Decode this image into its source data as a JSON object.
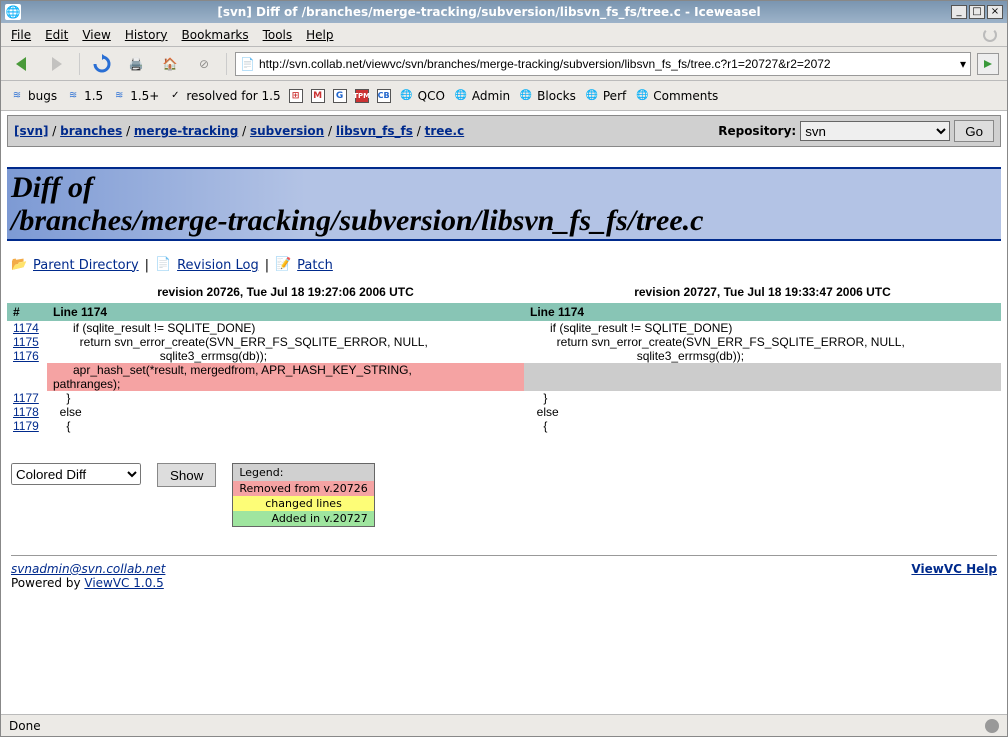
{
  "window": {
    "title": "[svn] Diff of /branches/merge-tracking/subversion/libsvn_fs_fs/tree.c - Iceweasel"
  },
  "menubar": {
    "items": [
      "File",
      "Edit",
      "View",
      "History",
      "Bookmarks",
      "Tools",
      "Help"
    ]
  },
  "url": "http://svn.collab.net/viewvc/svn/branches/merge-tracking/subversion/libsvn_fs_fs/tree.c?r1=20727&r2=2072",
  "bookmarks": {
    "bugs": "bugs",
    "v15": "1.5",
    "v15p": "1.5+",
    "resolved": "resolved for 1.5",
    "qco": "QCO",
    "admin": "Admin",
    "blocks": "Blocks",
    "perf": "Perf",
    "comments": "Comments"
  },
  "pathbar": {
    "root": "[svn]",
    "p1": "branches",
    "p2": "merge-tracking",
    "p3": "subversion",
    "p4": "libsvn_fs_fs",
    "p5": "tree.c",
    "sep": " / ",
    "repo_label": "Repository:",
    "repo_value": "svn",
    "go": "Go"
  },
  "heading": {
    "l1": "Diff of",
    "l2": "/branches/merge-tracking/subversion/libsvn_fs_fs/tree.c"
  },
  "actions": {
    "parent": "Parent Directory",
    "revlog": "Revision Log",
    "patch": "Patch",
    "sep": " | "
  },
  "diff": {
    "rev_left": "revision 20726, Tue Jul 18 19:27:06 2006 UTC",
    "rev_right": "revision 20727, Tue Jul 18 19:33:47 2006 UTC",
    "hash": "#",
    "line_left": "Line 1174",
    "line_right": "Line 1174",
    "rows": [
      {
        "ln": "1174",
        "l": "      if (sqlite_result != SQLITE_DONE)",
        "r": "      if (sqlite_result != SQLITE_DONE)"
      },
      {
        "ln": "1175",
        "l": "        return svn_error_create(SVN_ERR_FS_SQLITE_ERROR, NULL,",
        "r": "        return svn_error_create(SVN_ERR_FS_SQLITE_ERROR, NULL,"
      },
      {
        "ln": "1176",
        "l": "                                sqlite3_errmsg(db));",
        "r": "                                sqlite3_errmsg(db));"
      }
    ],
    "removed": {
      "l1": "",
      "l2": "      apr_hash_set(*result, mergedfrom, APR_HASH_KEY_STRING,",
      "l3": "pathranges);"
    },
    "rows2": [
      {
        "ln": "1177",
        "l": "    }",
        "r": "    }"
      },
      {
        "ln": "1178",
        "l": "  else",
        "r": "  else"
      },
      {
        "ln": "1179",
        "l": "    {",
        "r": "    {"
      }
    ]
  },
  "controls": {
    "mode": "Colored Diff",
    "show": "Show"
  },
  "legend": {
    "title": "Legend:",
    "removed": "Removed from v.20726",
    "changed": "changed lines",
    "added": "Added in v.20727"
  },
  "footer": {
    "email": "svnadmin@svn.collab.net",
    "powered": "Powered by ",
    "viewvc": "ViewVC 1.0.5",
    "help": "ViewVC Help"
  },
  "status": "Done"
}
